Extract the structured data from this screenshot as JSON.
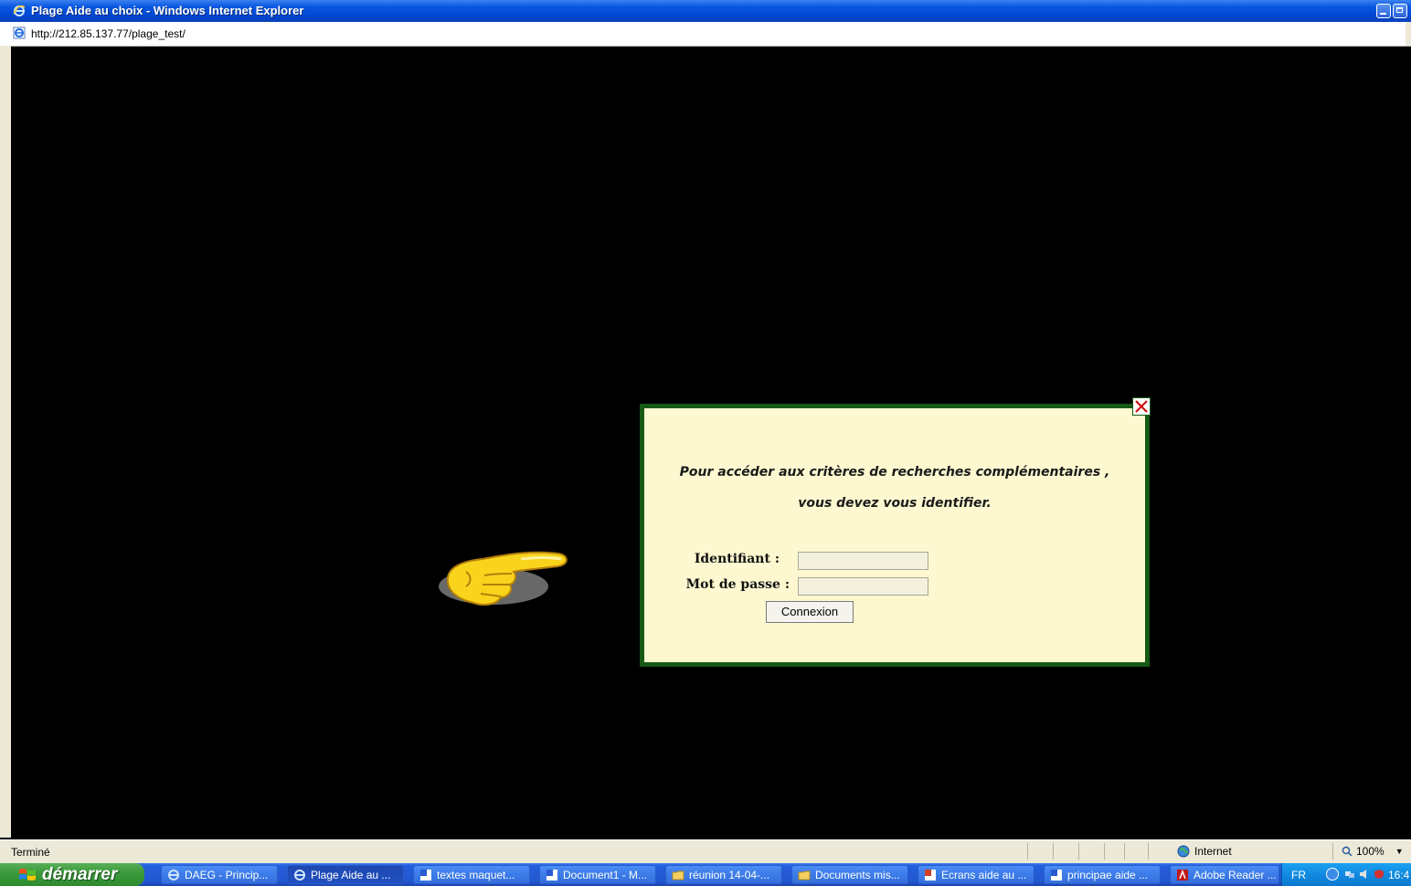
{
  "window": {
    "title": "Plage Aide au choix - Windows Internet Explorer",
    "url": "http://212.85.137.77/plage_test/"
  },
  "dialog": {
    "message_line1": "Pour accéder aux critères de recherches complémentaires ,",
    "message_line2": "vous devez vous identifier.",
    "username_label": "Identifiant :",
    "password_label": "Mot de passe :",
    "username_value": "",
    "password_value": "",
    "submit_label": "Connexion",
    "border_color": "#175915",
    "background_color": "#fdf8d0"
  },
  "statusbar": {
    "status_text": "Terminé",
    "zone_label": "Internet",
    "zoom_label": "100%"
  },
  "taskbar": {
    "start_label": "démarrer",
    "tasks": [
      {
        "label": "DAEG - Princip...",
        "icon": "ie-icon"
      },
      {
        "label": "Plage Aide au ...",
        "icon": "ie-icon"
      },
      {
        "label": "textes maquet...",
        "icon": "word-doc-icon"
      },
      {
        "label": "Document1 - M...",
        "icon": "word-doc-icon"
      },
      {
        "label": "réunion 14-04-...",
        "icon": "folder-icon"
      },
      {
        "label": "Documents mis...",
        "icon": "folder-icon"
      },
      {
        "label": "Ecrans aide au ...",
        "icon": "powerpoint-icon"
      },
      {
        "label": "principae aide ...",
        "icon": "word-doc-icon"
      },
      {
        "label": "Adobe Reader ...",
        "icon": "adobe-reader-icon"
      }
    ],
    "tray": {
      "language": "FR",
      "clock": "16:4"
    }
  }
}
